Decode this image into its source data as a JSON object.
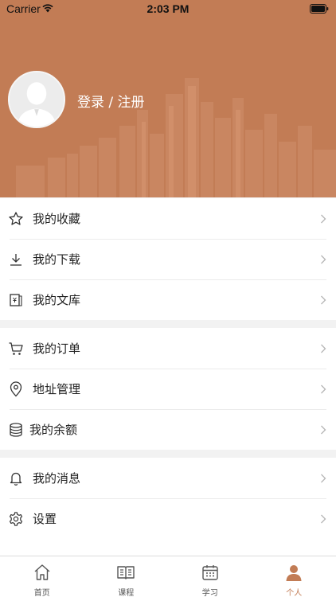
{
  "status_bar": {
    "carrier": "Carrier",
    "time": "2:03 PM"
  },
  "profile": {
    "login_label": "登录 / 注册"
  },
  "colors": {
    "accent": "#c27c55",
    "background": "#f2f2f2",
    "divider": "#ebebeb"
  },
  "menu_sections": [
    {
      "items": [
        {
          "label": "我的收藏",
          "icon": "star-icon"
        },
        {
          "label": "我的下载",
          "icon": "download-icon"
        },
        {
          "label": "我的文库",
          "icon": "library-book-icon"
        }
      ]
    },
    {
      "items": [
        {
          "label": "我的订单",
          "icon": "cart-icon"
        },
        {
          "label": "地址管理",
          "icon": "location-pin-icon"
        },
        {
          "label": "我的余额",
          "icon": "database-icon"
        }
      ]
    },
    {
      "items": [
        {
          "label": "我的消息",
          "icon": "bell-icon"
        },
        {
          "label": "设置",
          "icon": "gear-icon"
        }
      ]
    }
  ],
  "tabbar": {
    "active": "个人",
    "items": [
      {
        "label": "首页",
        "icon": "home-icon"
      },
      {
        "label": "课程",
        "icon": "book-icon"
      },
      {
        "label": "学习",
        "icon": "calendar-icon"
      },
      {
        "label": "个人",
        "icon": "person-icon"
      }
    ]
  }
}
